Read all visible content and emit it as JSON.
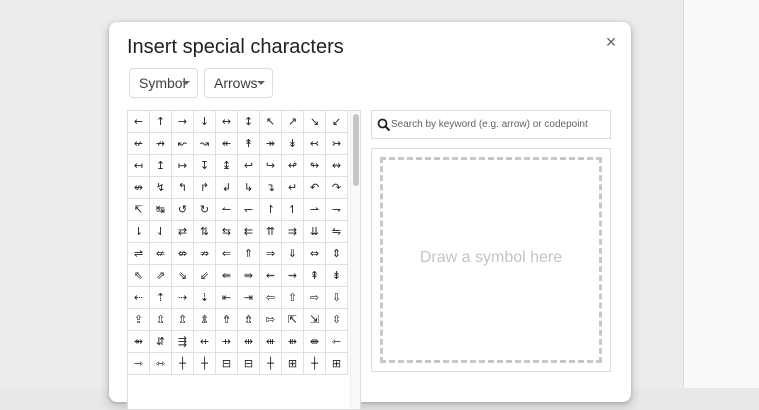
{
  "dialog": {
    "title": "Insert special characters",
    "close_symbol": "×",
    "category_dropdown": {
      "label": "Symbol"
    },
    "subcategory_dropdown": {
      "label": "Arrows"
    },
    "search": {
      "placeholder": "Search by keyword (e.g. arrow) or codepoint",
      "value": ""
    },
    "draw_area": {
      "placeholder": "Draw a symbol here"
    },
    "symbols": [
      "←",
      "↑",
      "→",
      "↓",
      "↔",
      "↕",
      "↖",
      "↗",
      "↘",
      "↙",
      "↚",
      "↛",
      "↜",
      "↝",
      "↞",
      "↟",
      "↠",
      "↡",
      "↢",
      "↣",
      "↤",
      "↥",
      "↦",
      "↧",
      "↨",
      "↩",
      "↪",
      "↫",
      "↬",
      "↭",
      "↮",
      "↯",
      "↰",
      "↱",
      "↲",
      "↳",
      "↴",
      "↵",
      "↶",
      "↷",
      "↸",
      "↹",
      "↺",
      "↻",
      "↼",
      "↽",
      "↾",
      "↿",
      "⇀",
      "⇁",
      "⇂",
      "⇃",
      "⇄",
      "⇅",
      "⇆",
      "⇇",
      "⇈",
      "⇉",
      "⇊",
      "⇋",
      "⇌",
      "⇍",
      "⇎",
      "⇏",
      "⇐",
      "⇑",
      "⇒",
      "⇓",
      "⇔",
      "⇕",
      "⇖",
      "⇗",
      "⇘",
      "⇙",
      "⇚",
      "⇛",
      "⇜",
      "⇝",
      "⇞",
      "⇟",
      "⇠",
      "⇡",
      "⇢",
      "⇣",
      "⇤",
      "⇥",
      "⇦",
      "⇧",
      "⇨",
      "⇩",
      "⇪",
      "⇫",
      "⇬",
      "⇭",
      "⇮",
      "⇯",
      "⇰",
      "⇱",
      "⇲",
      "⇳",
      "⇴",
      "⇵",
      "⇶",
      "⇷",
      "⇸",
      "⇹",
      "⇺",
      "⇻",
      "⇼",
      "⇽",
      "⇾",
      "⇿",
      "┼",
      "┼",
      "⊟",
      "⊟",
      "┼",
      "⊞",
      "┼",
      "⊞"
    ]
  }
}
